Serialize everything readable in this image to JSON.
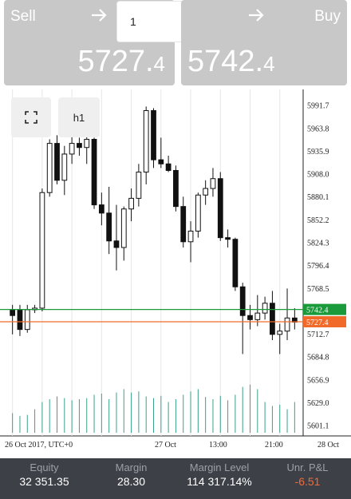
{
  "header": {
    "sell_label": "Sell",
    "buy_label": "Buy",
    "sell_price_main": "5727.",
    "sell_price_small": "4",
    "buy_price_main": "5742.",
    "buy_price_small": "4",
    "quantity_value": "1",
    "arrow_icon": "arrow-right-icon"
  },
  "controls": {
    "fullscreen_icon": "fullscreen-icon",
    "timeframe": "h1"
  },
  "chart_data": {
    "type": "candlestick",
    "y_ticks": [
      "5991.7",
      "5963.8",
      "5935.9",
      "5908.0",
      "5880.1",
      "5852.2",
      "5824.3",
      "5796.4",
      "5768.5",
      "5712.7",
      "5684.8",
      "5656.9",
      "5629.0",
      "5601.1"
    ],
    "ylim": [
      5592,
      6005
    ],
    "x_ticks": [
      "26 Oct 2017, UTC+0",
      "27 Oct",
      "13:00",
      "21:00",
      "28 Oct"
    ],
    "ask_line": {
      "value": 5742.4,
      "label": "5742.4",
      "color": "#1a9a3a"
    },
    "bid_line": {
      "value": 5727.4,
      "label": "5727.4",
      "color": "#f26a2a"
    },
    "volume_color": "#3aa08a",
    "grid": true,
    "candles": [
      {
        "o": 5742,
        "h": 5748,
        "l": 5712,
        "c": 5735
      },
      {
        "o": 5742,
        "h": 5748,
        "l": 5710,
        "c": 5718
      },
      {
        "o": 5718,
        "h": 5748,
        "l": 5714,
        "c": 5742
      },
      {
        "o": 5742,
        "h": 5748,
        "l": 5738,
        "c": 5744
      },
      {
        "o": 5744,
        "h": 5890,
        "l": 5740,
        "c": 5885
      },
      {
        "o": 5885,
        "h": 5950,
        "l": 5880,
        "c": 5945
      },
      {
        "o": 5945,
        "h": 5955,
        "l": 5895,
        "c": 5900
      },
      {
        "o": 5900,
        "h": 5942,
        "l": 5882,
        "c": 5932
      },
      {
        "o": 5932,
        "h": 5955,
        "l": 5920,
        "c": 5945
      },
      {
        "o": 5945,
        "h": 5952,
        "l": 5930,
        "c": 5940
      },
      {
        "o": 5940,
        "h": 5955,
        "l": 5920,
        "c": 5950
      },
      {
        "o": 5950,
        "h": 5952,
        "l": 5865,
        "c": 5870
      },
      {
        "o": 5870,
        "h": 5885,
        "l": 5845,
        "c": 5860
      },
      {
        "o": 5860,
        "h": 5892,
        "l": 5810,
        "c": 5826
      },
      {
        "o": 5826,
        "h": 5870,
        "l": 5790,
        "c": 5818
      },
      {
        "o": 5818,
        "h": 5868,
        "l": 5802,
        "c": 5865
      },
      {
        "o": 5865,
        "h": 5890,
        "l": 5850,
        "c": 5878
      },
      {
        "o": 5878,
        "h": 5920,
        "l": 5868,
        "c": 5910
      },
      {
        "o": 5910,
        "h": 5990,
        "l": 5895,
        "c": 5985
      },
      {
        "o": 5985,
        "h": 5988,
        "l": 5915,
        "c": 5925
      },
      {
        "o": 5925,
        "h": 5952,
        "l": 5915,
        "c": 5920
      },
      {
        "o": 5920,
        "h": 5930,
        "l": 5910,
        "c": 5912
      },
      {
        "o": 5912,
        "h": 5918,
        "l": 5862,
        "c": 5868
      },
      {
        "o": 5868,
        "h": 5880,
        "l": 5818,
        "c": 5825
      },
      {
        "o": 5825,
        "h": 5850,
        "l": 5800,
        "c": 5838
      },
      {
        "o": 5838,
        "h": 5885,
        "l": 5830,
        "c": 5882
      },
      {
        "o": 5882,
        "h": 5900,
        "l": 5870,
        "c": 5890
      },
      {
        "o": 5890,
        "h": 5915,
        "l": 5880,
        "c": 5902
      },
      {
        "o": 5902,
        "h": 5910,
        "l": 5826,
        "c": 5830
      },
      {
        "o": 5830,
        "h": 5840,
        "l": 5818,
        "c": 5828
      },
      {
        "o": 5828,
        "h": 5830,
        "l": 5765,
        "c": 5770
      },
      {
        "o": 5770,
        "h": 5775,
        "l": 5688,
        "c": 5735
      },
      {
        "o": 5735,
        "h": 5748,
        "l": 5718,
        "c": 5730
      },
      {
        "o": 5730,
        "h": 5760,
        "l": 5722,
        "c": 5738
      },
      {
        "o": 5738,
        "h": 5758,
        "l": 5730,
        "c": 5750
      },
      {
        "o": 5750,
        "h": 5765,
        "l": 5705,
        "c": 5712
      },
      {
        "o": 5712,
        "h": 5725,
        "l": 5688,
        "c": 5716
      },
      {
        "o": 5716,
        "h": 5768,
        "l": 5705,
        "c": 5732
      },
      {
        "o": 5732,
        "h": 5744,
        "l": 5718,
        "c": 5727
      }
    ],
    "volumes": [
      0.35,
      0.3,
      0.32,
      0.42,
      0.55,
      0.6,
      0.65,
      0.62,
      0.58,
      0.6,
      0.62,
      0.68,
      0.7,
      0.6,
      0.72,
      0.78,
      0.72,
      0.74,
      0.65,
      0.62,
      0.66,
      0.55,
      0.6,
      0.68,
      0.74,
      0.78,
      0.64,
      0.6,
      0.66,
      0.58,
      0.68,
      0.82,
      0.86,
      0.78,
      0.55,
      0.48,
      0.5,
      0.42,
      0.55
    ]
  },
  "footer": {
    "equity_label": "Equity",
    "equity_value": "32 351.35",
    "margin_label": "Margin",
    "margin_value": "28.30",
    "margin_level_label": "Margin Level",
    "margin_level_value": "114 317.14%",
    "upl_label": "Unr. P&L",
    "upl_value": "-6.51"
  }
}
